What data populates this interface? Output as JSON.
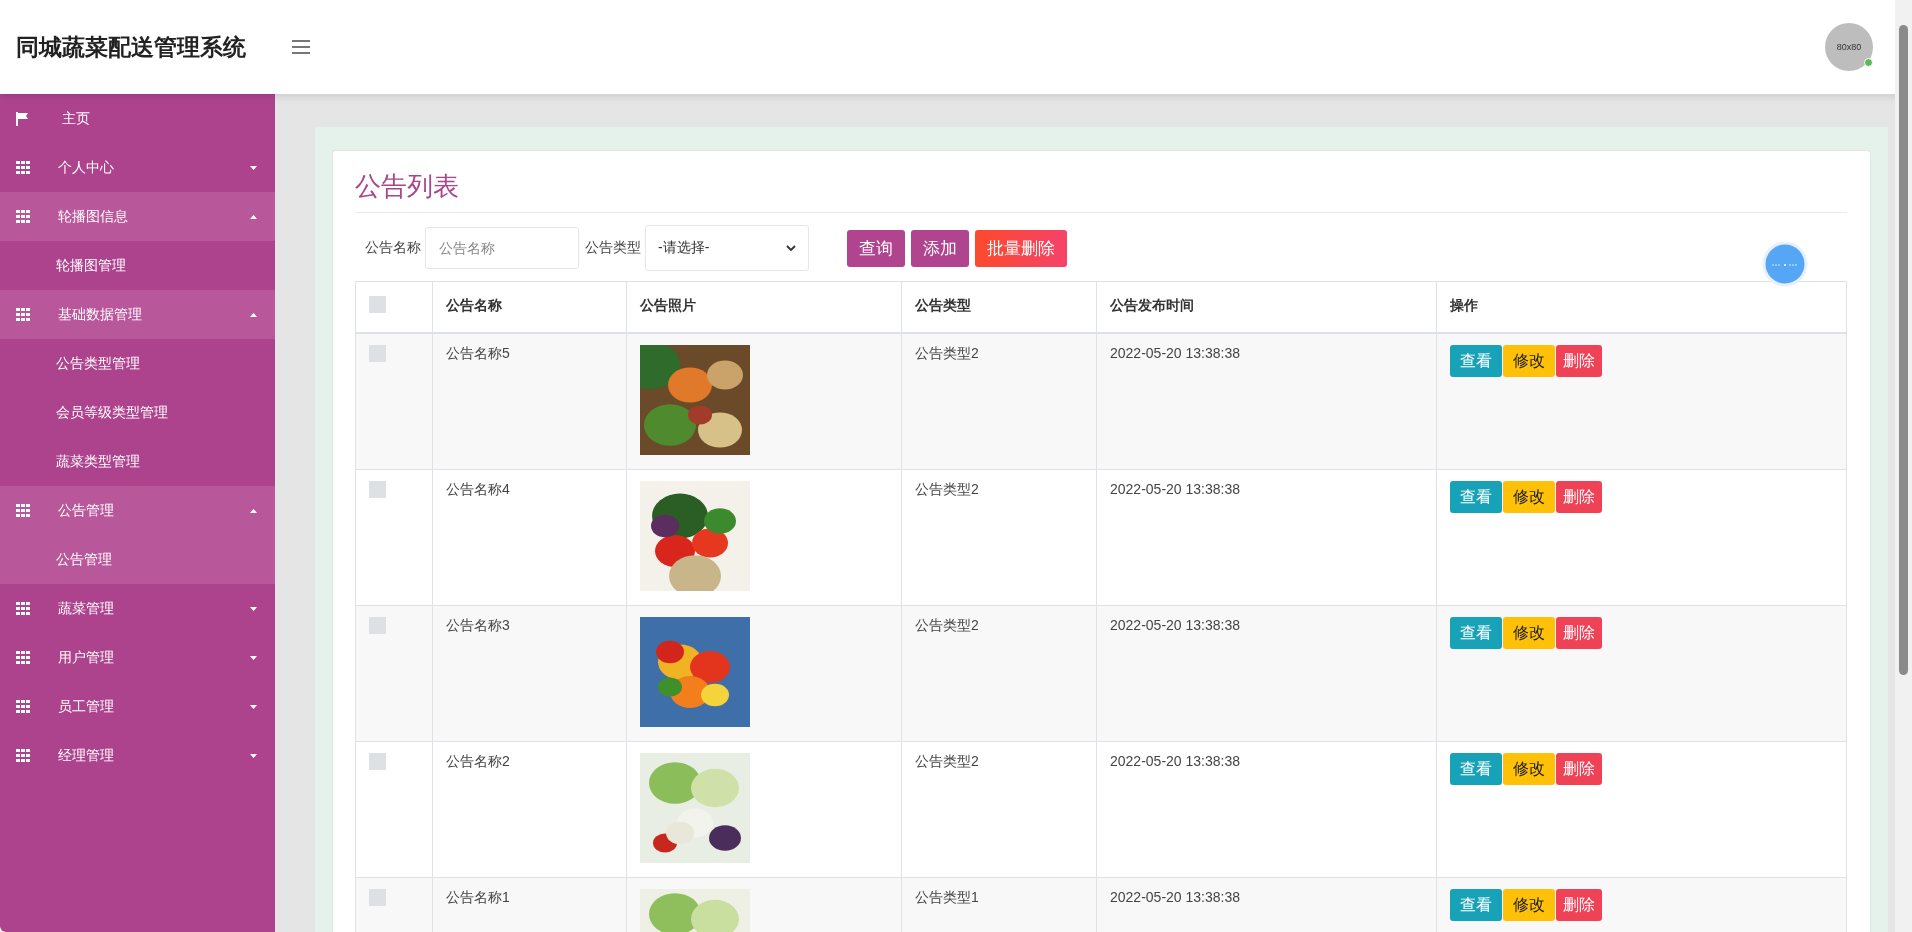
{
  "header": {
    "title": "同城蔬菜配送管理系统",
    "avatar_text": "80x80",
    "online": true
  },
  "sidebar": {
    "items": [
      {
        "label": "主页",
        "kind": "home"
      },
      {
        "label": "个人中心",
        "kind": "group",
        "expanded": false
      },
      {
        "label": "轮播图信息",
        "kind": "group",
        "expanded": true,
        "children": [
          {
            "label": "轮播图管理",
            "selected": false
          }
        ]
      },
      {
        "label": "基础数据管理",
        "kind": "group",
        "expanded": true,
        "children": [
          {
            "label": "公告类型管理",
            "selected": false
          },
          {
            "label": "会员等级类型管理",
            "selected": false
          },
          {
            "label": "蔬菜类型管理",
            "selected": false
          }
        ]
      },
      {
        "label": "公告管理",
        "kind": "group",
        "expanded": true,
        "children": [
          {
            "label": "公告管理",
            "selected": true
          }
        ]
      },
      {
        "label": "蔬菜管理",
        "kind": "group",
        "expanded": false
      },
      {
        "label": "用户管理",
        "kind": "group",
        "expanded": false
      },
      {
        "label": "员工管理",
        "kind": "group",
        "expanded": false
      },
      {
        "label": "经理管理",
        "kind": "group",
        "expanded": false
      }
    ]
  },
  "page_title": "公告列表",
  "filters": [
    {
      "kind": "input",
      "label": "公告名称",
      "placeholder": "公告名称"
    },
    {
      "kind": "select",
      "label": "公告类型",
      "value": "-请选择-"
    }
  ],
  "buttons": [
    {
      "label": "查询",
      "kind": "primary"
    },
    {
      "label": "添加",
      "kind": "primary"
    },
    {
      "label": "批量删除",
      "kind": "danger"
    }
  ],
  "table": {
    "header_checked": false,
    "columns": [
      "公告名称",
      "公告照片",
      "公告类型",
      "公告发布时间",
      "操作"
    ],
    "rows": [
      {
        "checked": false,
        "name": "公告名称5",
        "type": "公告类型2",
        "time": "2022-05-20 13:38:38",
        "actions": [
          {
            "label": "查看",
            "kind": "view"
          },
          {
            "label": "修改",
            "kind": "edit"
          },
          {
            "label": "删除",
            "kind": "delete"
          }
        ]
      },
      {
        "checked": false,
        "name": "公告名称4",
        "type": "公告类型2",
        "time": "2022-05-20 13:38:38",
        "actions": [
          {
            "label": "查看",
            "kind": "view"
          },
          {
            "label": "修改",
            "kind": "edit"
          },
          {
            "label": "删除",
            "kind": "delete"
          }
        ]
      },
      {
        "checked": false,
        "name": "公告名称3",
        "type": "公告类型2",
        "time": "2022-05-20 13:38:38",
        "actions": [
          {
            "label": "查看",
            "kind": "view"
          },
          {
            "label": "修改",
            "kind": "edit"
          },
          {
            "label": "删除",
            "kind": "delete"
          }
        ]
      },
      {
        "checked": false,
        "name": "公告名称2",
        "type": "公告类型2",
        "time": "2022-05-20 13:38:38",
        "actions": [
          {
            "label": "查看",
            "kind": "view"
          },
          {
            "label": "修改",
            "kind": "edit"
          },
          {
            "label": "删除",
            "kind": "delete"
          }
        ]
      },
      {
        "checked": false,
        "name": "公告名称1",
        "type": "公告类型1",
        "time": "2022-05-20 13:38:38",
        "actions": [
          {
            "label": "查看",
            "kind": "view"
          },
          {
            "label": "修改",
            "kind": "edit"
          },
          {
            "label": "删除",
            "kind": "delete"
          }
        ]
      }
    ]
  }
}
